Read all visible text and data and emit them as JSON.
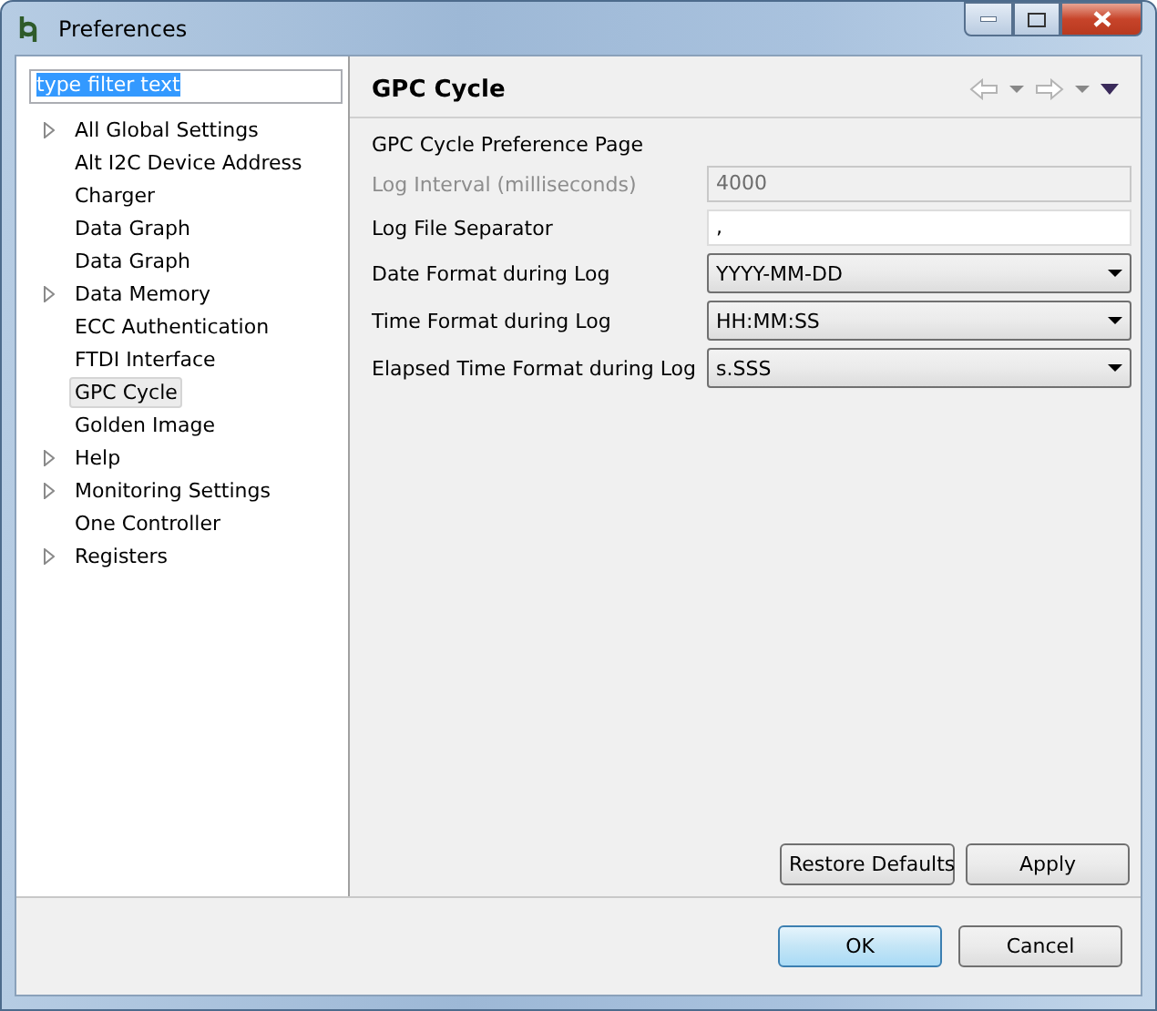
{
  "window": {
    "title": "Preferences"
  },
  "filter": {
    "value": "type filter text",
    "selected_text": true
  },
  "tree": [
    {
      "label": "All Global Settings",
      "expandable": true,
      "selected": false
    },
    {
      "label": "Alt I2C Device Address",
      "expandable": false,
      "selected": false
    },
    {
      "label": "Charger",
      "expandable": false,
      "selected": false
    },
    {
      "label": "Data Graph",
      "expandable": false,
      "selected": false
    },
    {
      "label": "Data Graph",
      "expandable": false,
      "selected": false
    },
    {
      "label": "Data Memory",
      "expandable": true,
      "selected": false
    },
    {
      "label": "ECC Authentication",
      "expandable": false,
      "selected": false
    },
    {
      "label": "FTDI Interface",
      "expandable": false,
      "selected": false
    },
    {
      "label": "GPC Cycle",
      "expandable": false,
      "selected": true
    },
    {
      "label": "Golden Image",
      "expandable": false,
      "selected": false
    },
    {
      "label": "Help",
      "expandable": true,
      "selected": false
    },
    {
      "label": "Monitoring Settings",
      "expandable": true,
      "selected": false
    },
    {
      "label": "One Controller",
      "expandable": false,
      "selected": false
    },
    {
      "label": "Registers",
      "expandable": true,
      "selected": false
    }
  ],
  "page": {
    "title": "GPC Cycle",
    "description": "GPC Cycle Preference Page",
    "fields": [
      {
        "kind": "text",
        "label": "Log Interval (milliseconds)",
        "value": "4000",
        "disabled": true
      },
      {
        "kind": "text",
        "label": "Log File Separator",
        "value": ",",
        "disabled": false
      },
      {
        "kind": "combo",
        "label": "Date Format during Log",
        "value": "YYYY-MM-DD",
        "disabled": false
      },
      {
        "kind": "combo",
        "label": "Time Format during Log",
        "value": "HH:MM:SS",
        "disabled": false
      },
      {
        "kind": "combo",
        "label": "Elapsed Time Format during Log",
        "value": "s.SSS",
        "disabled": false
      }
    ],
    "buttons": [
      "Restore Defaults",
      "Apply"
    ]
  },
  "footer_buttons": [
    {
      "label": "OK",
      "default": true
    },
    {
      "label": "Cancel",
      "default": false
    }
  ]
}
